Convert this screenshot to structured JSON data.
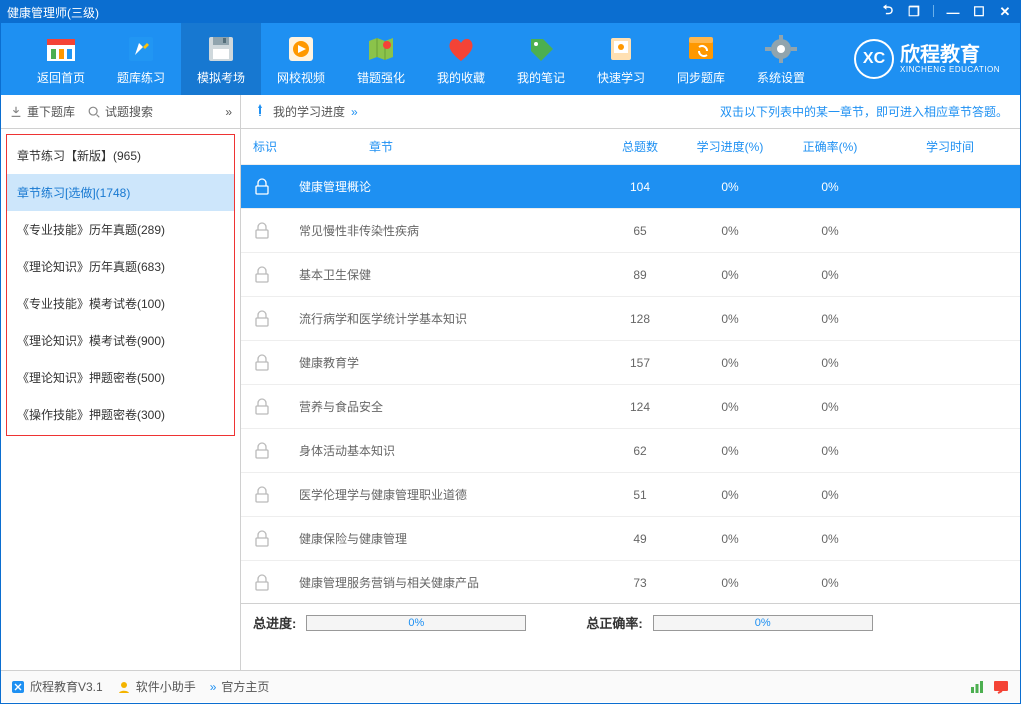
{
  "window": {
    "title": "健康管理师(三级)"
  },
  "toolbar": {
    "items": [
      {
        "label": "返回首页",
        "icon": "home"
      },
      {
        "label": "题库练习",
        "icon": "notebook"
      },
      {
        "label": "模拟考场",
        "icon": "save",
        "selected": true
      },
      {
        "label": "网校视频",
        "icon": "video"
      },
      {
        "label": "错题强化",
        "icon": "map"
      },
      {
        "label": "我的收藏",
        "icon": "heart"
      },
      {
        "label": "我的笔记",
        "icon": "tag"
      },
      {
        "label": "快速学习",
        "icon": "safe"
      },
      {
        "label": "同步题库",
        "icon": "sync"
      },
      {
        "label": "系统设置",
        "icon": "gear"
      }
    ],
    "brand_cn": "欣程教育",
    "brand_en": "XINCHENG EDUCATION",
    "brand_logo": "XC"
  },
  "sidebar": {
    "tools": {
      "redownload": "重下题库",
      "search": "试题搜索"
    },
    "items": [
      "章节练习【新版】(965)",
      "章节练习[选做](1748)",
      "《专业技能》历年真题(289)",
      "《理论知识》历年真题(683)",
      "《专业技能》模考试卷(100)",
      "《理论知识》模考试卷(900)",
      "《理论知识》押题密卷(500)",
      "《操作技能》押题密卷(300)"
    ],
    "active_index": 1
  },
  "content": {
    "progress_label": "我的学习进度",
    "hint": "双击以下列表中的某一章节，即可进入相应章节答题。",
    "columns": {
      "mark": "标识",
      "chapter": "章节",
      "count": "总题数",
      "progress": "学习进度(%)",
      "accuracy": "正确率(%)",
      "time": "学习时间"
    },
    "rows": [
      {
        "chapter": "健康管理概论",
        "count": 104,
        "progress": "0%",
        "accuracy": "0%",
        "selected": true
      },
      {
        "chapter": "常见慢性非传染性疾病",
        "count": 65,
        "progress": "0%",
        "accuracy": "0%"
      },
      {
        "chapter": "基本卫生保健",
        "count": 89,
        "progress": "0%",
        "accuracy": "0%"
      },
      {
        "chapter": "流行病学和医学统计学基本知识",
        "count": 128,
        "progress": "0%",
        "accuracy": "0%"
      },
      {
        "chapter": "健康教育学",
        "count": 157,
        "progress": "0%",
        "accuracy": "0%"
      },
      {
        "chapter": "营养与食品安全",
        "count": 124,
        "progress": "0%",
        "accuracy": "0%"
      },
      {
        "chapter": "身体活动基本知识",
        "count": 62,
        "progress": "0%",
        "accuracy": "0%"
      },
      {
        "chapter": "医学伦理学与健康管理职业道德",
        "count": 51,
        "progress": "0%",
        "accuracy": "0%"
      },
      {
        "chapter": "健康保险与健康管理",
        "count": 49,
        "progress": "0%",
        "accuracy": "0%"
      },
      {
        "chapter": "健康管理服务营销与相关健康产品",
        "count": 73,
        "progress": "0%",
        "accuracy": "0%"
      }
    ],
    "summary": {
      "total_progress_label": "总进度:",
      "total_progress_value": "0%",
      "total_accuracy_label": "总正确率:",
      "total_accuracy_value": "0%"
    }
  },
  "statusbar": {
    "app_version": "欣程教育V3.1",
    "helper": "软件小助手",
    "official": "官方主页"
  }
}
